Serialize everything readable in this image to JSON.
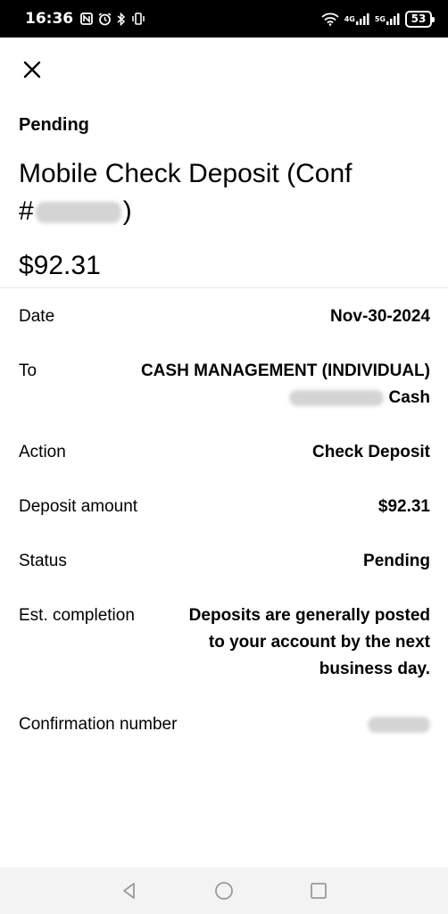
{
  "status_bar": {
    "time": "16:36",
    "net_label_1": "4G",
    "net_label_2": "5G",
    "battery": "53"
  },
  "header": {
    "status": "Pending",
    "title_line1": "Mobile Check Deposit (Conf",
    "title_prefix": "#",
    "title_suffix": ")",
    "amount": "$92.31"
  },
  "details": {
    "date": {
      "label": "Date",
      "value": "Nov-30-2024"
    },
    "to": {
      "label": "To",
      "value_line1": "CASH MANAGEMENT (INDIVIDUAL)",
      "value_line2": "Cash"
    },
    "action": {
      "label": "Action",
      "value": "Check Deposit"
    },
    "deposit_amount": {
      "label": "Deposit amount",
      "value": "$92.31"
    },
    "status": {
      "label": "Status",
      "value": "Pending"
    },
    "est_completion": {
      "label": "Est. completion",
      "value_line1": "Deposits are generally posted",
      "value_line2": "to your account by the next",
      "value_line3": "business day."
    },
    "confirmation": {
      "label": "Confirmation number"
    }
  },
  "icons": {
    "close": "close-icon",
    "back": "back-triangle-icon",
    "home": "home-circle-icon",
    "recents": "recents-square-icon"
  }
}
